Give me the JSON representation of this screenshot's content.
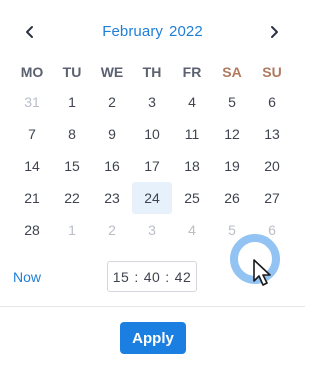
{
  "header": {
    "month": "February",
    "year": "2022",
    "prev_icon": "chevron-left-icon",
    "next_icon": "chevron-right-icon"
  },
  "weekdays": [
    "MO",
    "TU",
    "WE",
    "TH",
    "FR",
    "SA",
    "SU"
  ],
  "weeks": [
    [
      {
        "d": "31",
        "muted": true
      },
      {
        "d": "1"
      },
      {
        "d": "2"
      },
      {
        "d": "3"
      },
      {
        "d": "4"
      },
      {
        "d": "5"
      },
      {
        "d": "6"
      }
    ],
    [
      {
        "d": "7"
      },
      {
        "d": "8"
      },
      {
        "d": "9"
      },
      {
        "d": "10"
      },
      {
        "d": "11"
      },
      {
        "d": "12"
      },
      {
        "d": "13"
      }
    ],
    [
      {
        "d": "14"
      },
      {
        "d": "15"
      },
      {
        "d": "16"
      },
      {
        "d": "17"
      },
      {
        "d": "18"
      },
      {
        "d": "19"
      },
      {
        "d": "20"
      }
    ],
    [
      {
        "d": "21"
      },
      {
        "d": "22"
      },
      {
        "d": "23"
      },
      {
        "d": "24",
        "selected": true
      },
      {
        "d": "25"
      },
      {
        "d": "26"
      },
      {
        "d": "27"
      }
    ],
    [
      {
        "d": "28"
      },
      {
        "d": "1",
        "muted": true
      },
      {
        "d": "2",
        "muted": true
      },
      {
        "d": "3",
        "muted": true
      },
      {
        "d": "4",
        "muted": true
      },
      {
        "d": "5",
        "muted": true
      },
      {
        "d": "6",
        "muted": true
      }
    ]
  ],
  "footer": {
    "now_label": "Now",
    "time": {
      "hours": "15",
      "minutes": "40",
      "seconds": "42",
      "separator": ":"
    },
    "apply_label": "Apply"
  },
  "colors": {
    "accent": "#1f7fd6",
    "apply_bg": "#1a7fe0",
    "selected_bg": "#e6f1fc",
    "weekend_header": "#b07a5e",
    "muted_day": "#b9bec7"
  }
}
